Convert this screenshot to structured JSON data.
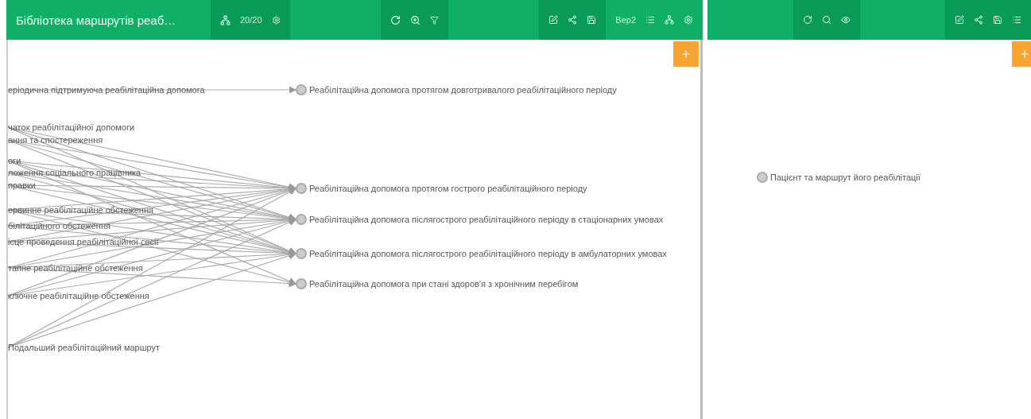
{
  "editor": {
    "title": "Бібліотека маршрутів реаб…",
    "counter": "20/20",
    "version": "Вер2",
    "sources": [
      "еріодична підтримуюча реабілітаційна допомога",
      "чаток реабілітаційної допомоги",
      "ання та спостереження",
      "оги",
      "ложення соціального працівника",
      "правки",
      "ервинне реабілітаційне обстеження",
      "білітаційного обстеження",
      "ісце проведення реабілітаційної сесії",
      "тапне реабілітаційне обстеження",
      "ключне реабілітаційне обстеження",
      "Подальший реабілітаційний маршрут"
    ],
    "targets": [
      "Реабілітаційна допомога протягом довготривалого реабілітаційного періоду",
      "Реабілітаційна допомога протягом гострого реабілітаційного періоду",
      "Реабілітаційна допомога післягострого реабілітаційного періоду в стаціонарних умовах",
      "Реабілітаційна допомога післягострого реабілітаційного періоду в амбулаторних умовах",
      "Реабілітаційна допомога при стані здоров'я з хронічним перебігом"
    ]
  },
  "viewer": {
    "nodes": [
      "Пацієнт та маршрут його реабілітації"
    ]
  }
}
